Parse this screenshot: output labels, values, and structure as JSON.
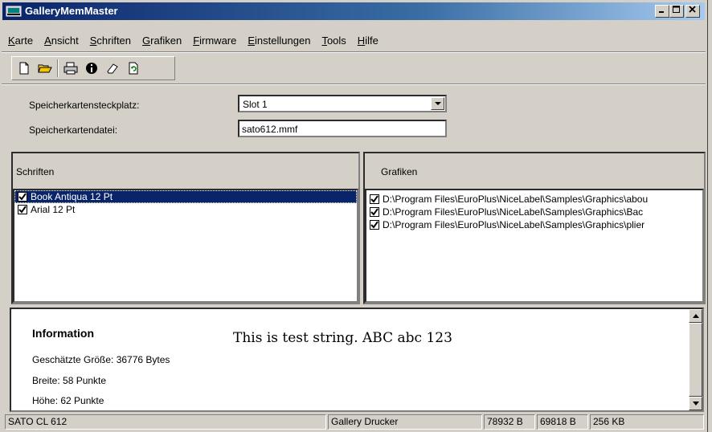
{
  "window": {
    "title": "GalleryMemMaster"
  },
  "menu": [
    "Karte",
    "Ansicht",
    "Schriften",
    "Grafiken",
    "Firmware",
    "Einstellungen",
    "Tools",
    "Hilfe"
  ],
  "toolbar": {
    "icons": [
      "new-document-icon",
      "open-folder-icon",
      "printer-icon",
      "info-icon",
      "eraser-icon",
      "refresh-icon"
    ]
  },
  "settings": {
    "slot_label": "Speicherkartensteckplatz:",
    "slot_value": "Slot 1",
    "file_label": "Speicherkartendatei:",
    "file_value": "sato612.mmf"
  },
  "fonts_panel": {
    "header": "Schriften",
    "items": [
      {
        "label": "Book Antiqua 12 Pt",
        "checked": true,
        "selected": true
      },
      {
        "label": "Arial 12 Pt",
        "checked": true,
        "selected": false
      }
    ]
  },
  "graphics_panel": {
    "header": "Grafiken",
    "items": [
      {
        "label": "D:\\Program Files\\EuroPlus\\NiceLabel\\Samples\\Graphics\\abou",
        "checked": true
      },
      {
        "label": "D:\\Program Files\\EuroPlus\\NiceLabel\\Samples\\Graphics\\Bac",
        "checked": true
      },
      {
        "label": "D:\\Program Files\\EuroPlus\\NiceLabel\\Samples\\Graphics\\plier",
        "checked": true
      }
    ]
  },
  "info": {
    "heading": "Information",
    "preview": "This is test string. ABC abc 123",
    "size": "Geschätzte Größe: 36776 Bytes",
    "width": "Breite: 58 Punkte",
    "height": "Höhe: 62 Punkte"
  },
  "status": {
    "printer": "SATO CL 612",
    "driver": "Gallery Drucker",
    "mem1": "78932 B",
    "mem2": "69818 B",
    "mem3": "256 KB"
  }
}
